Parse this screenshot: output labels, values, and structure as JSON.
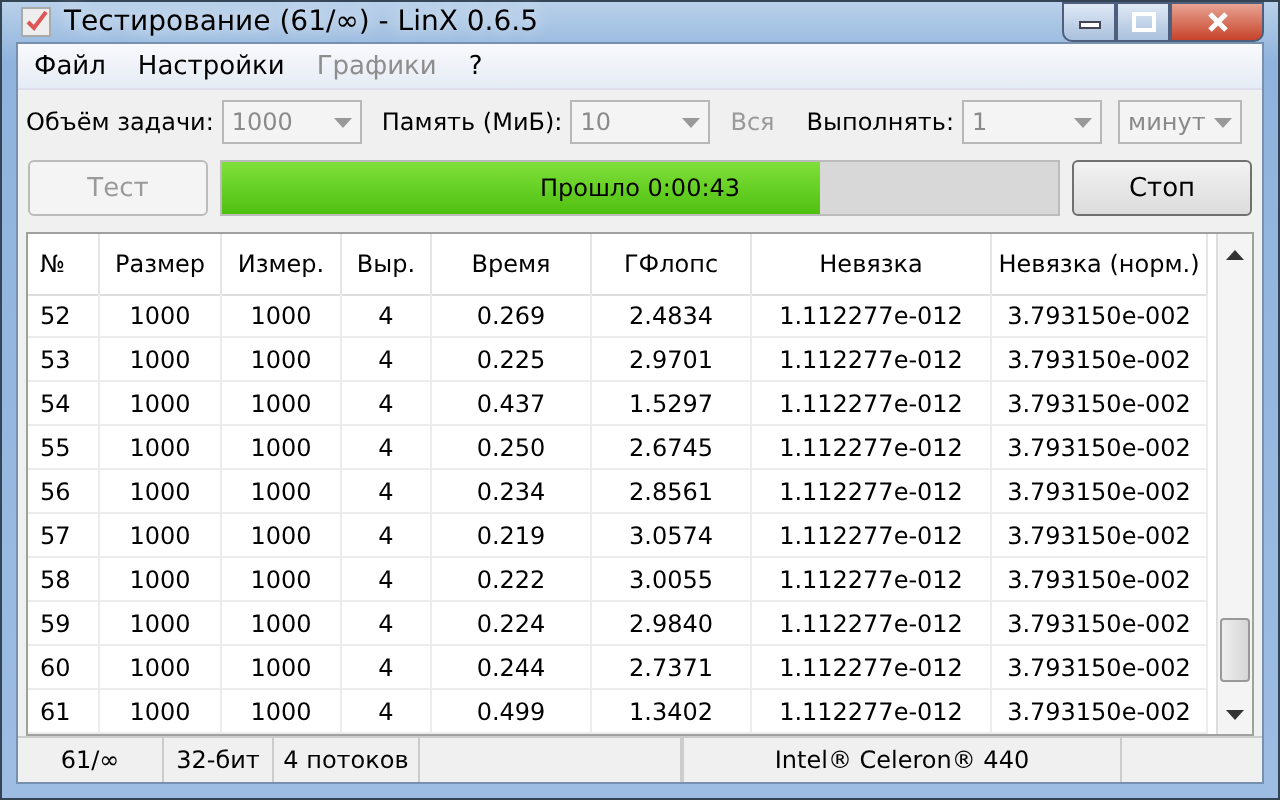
{
  "window": {
    "title": "Тестирование (61/∞) - LinX 0.6.5"
  },
  "menu": [
    {
      "label": "Файл",
      "disabled": false
    },
    {
      "label": "Настройки",
      "disabled": false
    },
    {
      "label": "Графики",
      "disabled": true
    },
    {
      "label": "?",
      "disabled": false
    }
  ],
  "options": [
    {
      "kind": "combo",
      "label": "Объём задачи:",
      "value": "1000",
      "disabled": true
    },
    {
      "kind": "combo",
      "label": "Память (МиБ):",
      "value": "10",
      "disabled": true
    },
    {
      "kind": "check",
      "label": "Вся",
      "disabled": true
    },
    {
      "kind": "combo",
      "label": "Выполнять:",
      "value": "1",
      "disabled": true
    },
    {
      "kind": "combo",
      "value": "минут",
      "disabled": true
    }
  ],
  "test_button": {
    "label": "Тест",
    "disabled": true
  },
  "progress": {
    "label": "Прошло 0:00:43",
    "level": 0.716
  },
  "stop_button": {
    "label": "Стоп",
    "disabled": false
  },
  "table": {
    "columns": [
      "№",
      "Размер",
      "Измер.",
      "Выр.",
      "Время",
      "ГФлопс",
      "Невязка",
      "Невязка (норм.)"
    ],
    "rows": [
      [
        "52",
        "1000",
        "1000",
        "4",
        "0.269",
        "2.4834",
        "1.112277e-012",
        "3.793150e-002"
      ],
      [
        "53",
        "1000",
        "1000",
        "4",
        "0.225",
        "2.9701",
        "1.112277e-012",
        "3.793150e-002"
      ],
      [
        "54",
        "1000",
        "1000",
        "4",
        "0.437",
        "1.5297",
        "1.112277e-012",
        "3.793150e-002"
      ],
      [
        "55",
        "1000",
        "1000",
        "4",
        "0.250",
        "2.6745",
        "1.112277e-012",
        "3.793150e-002"
      ],
      [
        "56",
        "1000",
        "1000",
        "4",
        "0.234",
        "2.8561",
        "1.112277e-012",
        "3.793150e-002"
      ],
      [
        "57",
        "1000",
        "1000",
        "4",
        "0.219",
        "3.0574",
        "1.112277e-012",
        "3.793150e-002"
      ],
      [
        "58",
        "1000",
        "1000",
        "4",
        "0.222",
        "3.0055",
        "1.112277e-012",
        "3.793150e-002"
      ],
      [
        "59",
        "1000",
        "1000",
        "4",
        "0.224",
        "2.9840",
        "1.112277e-012",
        "3.793150e-002"
      ],
      [
        "60",
        "1000",
        "1000",
        "4",
        "0.244",
        "2.7371",
        "1.112277e-012",
        "3.793150e-002"
      ],
      [
        "61",
        "1000",
        "1000",
        "4",
        "0.499",
        "1.3402",
        "1.112277e-012",
        "3.793150e-002"
      ]
    ]
  },
  "status_bar": [
    "61/∞",
    "32-бит",
    "4 потоков",
    "Intel® Celeron® 440"
  ]
}
